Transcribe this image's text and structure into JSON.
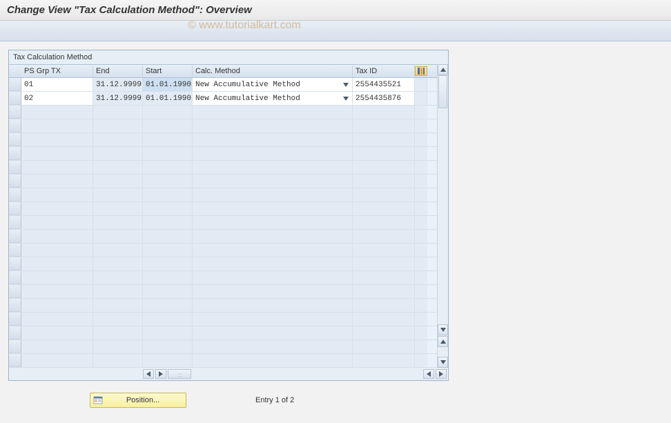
{
  "title": "Change View \"Tax Calculation Method\": Overview",
  "watermark": "© www.tutorialkart.com",
  "panel": {
    "title": "Tax Calculation Method"
  },
  "columns": {
    "ps": "PS Grp TX",
    "end": "End",
    "start": "Start",
    "calc": "Calc. Method",
    "tax": "Tax ID"
  },
  "rows": [
    {
      "ps": "01",
      "end": "31.12.9999",
      "start": "01.01.1990",
      "calc": "New Accumulative Method",
      "tax": "2554435521"
    },
    {
      "ps": "02",
      "end": "31.12.9999",
      "start": "01.01.1990",
      "calc": "New Accumulative Method",
      "tax": "2554435876"
    }
  ],
  "footer": {
    "position_label": "Position...",
    "entry_text": "Entry 1 of 2"
  },
  "empty_row_count": 19
}
